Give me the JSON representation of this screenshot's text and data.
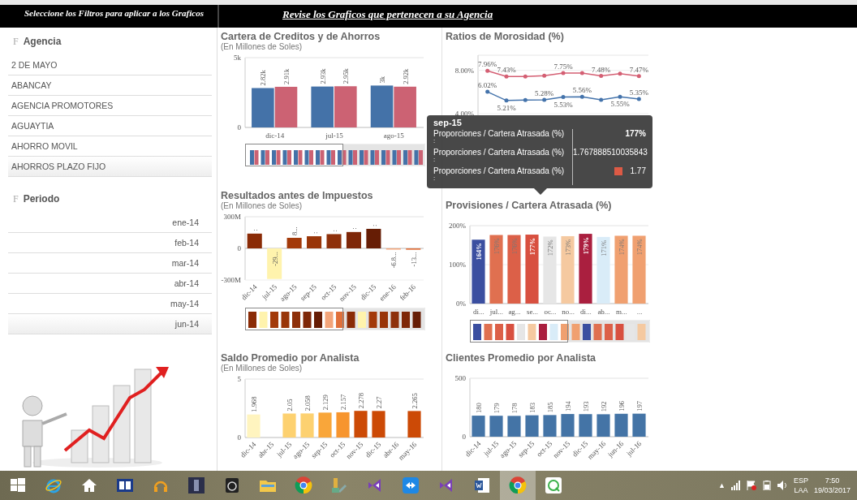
{
  "header": {
    "left_title": "Seleccione los Filtros para aplicar a los Graficos",
    "right_title": "Revise los Graficos que pertenecen a su Agencia"
  },
  "filters": [
    {
      "icon": "F",
      "title": "Agencia",
      "kind": "text",
      "items": [
        "2 DE MAYO",
        "ABANCAY",
        "AGENCIA PROMOTORES",
        "AGUAYTIA",
        "AHORRO MOVIL",
        "AHORROS PLAZO FIJO"
      ]
    },
    {
      "icon": "F",
      "title": "Periodo",
      "kind": "date",
      "items": [
        "ene-14",
        "feb-14",
        "mar-14",
        "abr-14",
        "may-14",
        "jun-14"
      ]
    }
  ],
  "charts": [
    {
      "title": "Cartera de Creditos y de Ahorros",
      "subtitle": "(En Millones de Soles)",
      "chart_data": {
        "type": "bar",
        "categories": [
          "dic-14",
          "jul-15",
          "ago-15"
        ],
        "ylim": [
          0,
          5000
        ],
        "yticks": [
          {
            "value": 0,
            "label": "0"
          },
          {
            "value": 5000,
            "label": "5k"
          }
        ],
        "series": [
          {
            "color": "#4472a8",
            "values": [
              2820,
              2930,
              3000
            ],
            "value_labels": [
              "2.82k",
              "2.93k",
              "3k"
            ]
          },
          {
            "color": "#cc6273",
            "values": [
              2910,
              2950,
              2920
            ],
            "value_labels": [
              "2.91k",
              "2.95k",
              "2.92k"
            ]
          }
        ]
      }
    },
    {
      "title": "Ratios de Morosidad (%)",
      "chart_data": {
        "type": "line",
        "ylim": [
          3.85,
          9.4
        ],
        "yticks": [
          {
            "value": 4,
            "label": "4.00%"
          },
          {
            "value": 8,
            "label": "8.00%"
          }
        ],
        "series": [
          {
            "color": "#d45f73",
            "values": [
              7.96,
              7.43,
              7.43,
              7.5,
              7.75,
              7.75,
              7.48,
              7.7,
              7.47
            ],
            "value_labels": [
              "7.96%",
              "7.43%",
              null,
              null,
              "7.75%",
              null,
              "7.48%",
              null,
              "7.47%"
            ]
          },
          {
            "color": "#4473ab",
            "values": [
              6.02,
              5.21,
              5.25,
              5.28,
              5.53,
              5.56,
              5.28,
              5.55,
              5.35
            ],
            "value_labels": [
              "6.02%",
              "5.21%",
              null,
              "5.28%",
              "5.53%",
              "5.56%",
              null,
              "5.55%",
              "5.35%"
            ]
          }
        ]
      }
    },
    {
      "title": "Resultados antes de Impuestos",
      "subtitle": "(En Millones de Soles)",
      "chart_data": {
        "type": "bar",
        "categories": [
          "dic-14",
          "jul-15",
          "ago-15",
          "sep-15",
          "oct-15",
          "nov-15",
          "dic-15",
          "ene-16",
          "feb-16"
        ],
        "ylim": [
          -300,
          300
        ],
        "yticks": [
          {
            "value": -300,
            "label": "-300M"
          },
          {
            "value": 0,
            "label": "0"
          },
          {
            "value": 300,
            "label": "300M"
          }
        ],
        "series": [
          {
            "colors": [
              "#8a2b06",
              "#fff3ad",
              "#a33a0a",
              "#993508",
              "#8e300a",
              "#7e2708",
              "#661d05",
              "#f3a57a",
              "#e0703a"
            ],
            "values": [
              140,
              -290,
              100,
              115,
              135,
              155,
              185,
              -6.8,
              -13
            ],
            "value_labels": [
              ":",
              "-29...",
              "8...",
              ":",
              ":",
              ":",
              ":",
              "-6.8...",
              "-13..."
            ]
          }
        ]
      }
    },
    {
      "title": "Provisiones / Cartera Atrasada (%)",
      "chart_data": {
        "type": "bar",
        "categories": [
          "di...",
          "jul...",
          "ag...",
          "se...",
          "oc...",
          "no...",
          "di...",
          "ab...",
          "m...",
          "..."
        ],
        "ylim": [
          0,
          200
        ],
        "yticks": [
          {
            "value": 0,
            "label": "0%"
          },
          {
            "value": 100,
            "label": "100%"
          },
          {
            "value": 200,
            "label": "200%"
          }
        ],
        "series": [
          {
            "colors": [
              "#3b4fa0",
              "#e07050",
              "#dc6048",
              "#d85040",
              "#e6e6e6",
              "#f5c9a0",
              "#aa1f3f",
              "#d9ecf8",
              "#f0a070",
              "#f0a070"
            ],
            "values": [
              164,
              176,
              176,
              177,
              172,
              173,
              179,
              171,
              174,
              174
            ],
            "value_labels": [
              "164%",
              "176%",
              "176%",
              "177%",
              "172%",
              "173%",
              "179%",
              "171%",
              "174%",
              "174%"
            ]
          }
        ]
      }
    },
    {
      "title": "Saldo Promedio por Analista",
      "subtitle": "(En Millones de Soles)",
      "chart_data": {
        "type": "bar",
        "categories": [
          "dic-14",
          "abr-15",
          "jul-15",
          "ago-15",
          "sep-15",
          "oct-15",
          "nov-15",
          "dic-15",
          "abr-16",
          "may-16"
        ],
        "ylim": [
          0,
          5
        ],
        "yticks": [
          {
            "value": 0,
            "label": "0"
          },
          {
            "value": 5,
            "label": "5"
          }
        ],
        "series": [
          {
            "colors": [
              "#fff4bf",
              null,
              "#fdd170",
              "#fdd170",
              "#f9a63a",
              "#f7952e",
              "#cc4a06",
              "#cc4a06",
              null,
              "#cc4a06"
            ],
            "values": [
              1.968,
              null,
              2.05,
              2.058,
              2.129,
              2.157,
              2.278,
              2.27,
              null,
              2.265
            ],
            "value_labels": [
              "1.968",
              null,
              "2.05",
              "2.058",
              "2.129",
              "2.157",
              "2.278",
              "2.27",
              null,
              "2.265"
            ]
          }
        ]
      }
    },
    {
      "title": "Clientes Promedio por Analista",
      "chart_data": {
        "type": "bar",
        "categories": [
          "dic-14",
          "jul-15",
          "ago-15",
          "sep-15",
          "oct-15",
          "nov-15",
          "dic-15",
          "may-16",
          "jun-16",
          "jul-16"
        ],
        "ylim": [
          0,
          500
        ],
        "yticks": [
          {
            "value": 0,
            "label": "0"
          },
          {
            "value": 500,
            "label": "500"
          }
        ],
        "series": [
          {
            "color": "#4474a6",
            "values": [
              180,
              179,
              178,
              183,
              185,
              194,
              193,
              192,
              196,
              197
            ],
            "value_labels": [
              "180",
              "179",
              "178",
              "183",
              "185",
              "194",
              "193",
              "192",
              "196",
              "197"
            ]
          }
        ]
      }
    }
  ],
  "tooltip": {
    "title": "sep-15",
    "rows": [
      {
        "label": "Proporciones / Cartera Atrasada (%)",
        "sub": ":",
        "value": "177%"
      },
      {
        "label": "Proporciones / Cartera Atrasada (%)",
        "sub": ":",
        "value": "1.767888510035843"
      },
      {
        "label": "Proporciones / Cartera Atrasada (%)",
        "sub": ":",
        "value": "1.77",
        "color": "#dd5a45"
      }
    ]
  },
  "taskbar": {
    "apps": [
      {
        "kind": "start",
        "selected": false
      },
      {
        "kind": "browser",
        "selected": false
      },
      {
        "kind": "home",
        "selected": false
      },
      {
        "kind": "media",
        "selected": false
      },
      {
        "kind": "headphones",
        "selected": false
      },
      {
        "kind": "album",
        "selected": false
      },
      {
        "kind": "timer",
        "selected": false
      },
      {
        "kind": "folder",
        "selected": false
      },
      {
        "kind": "globe",
        "selected": false
      },
      {
        "kind": "tools",
        "selected": false
      },
      {
        "kind": "studio",
        "selected": false
      },
      {
        "kind": "remote",
        "selected": false
      },
      {
        "kind": "studio",
        "selected": false
      },
      {
        "kind": "document",
        "selected": false
      },
      {
        "kind": "globe",
        "selected": true
      },
      {
        "kind": "chat",
        "selected": false
      }
    ],
    "tray": {
      "arrow": "▲",
      "language": "ESP",
      "layout": "LAA",
      "time": "7:50",
      "date": "19/03/2017"
    }
  }
}
